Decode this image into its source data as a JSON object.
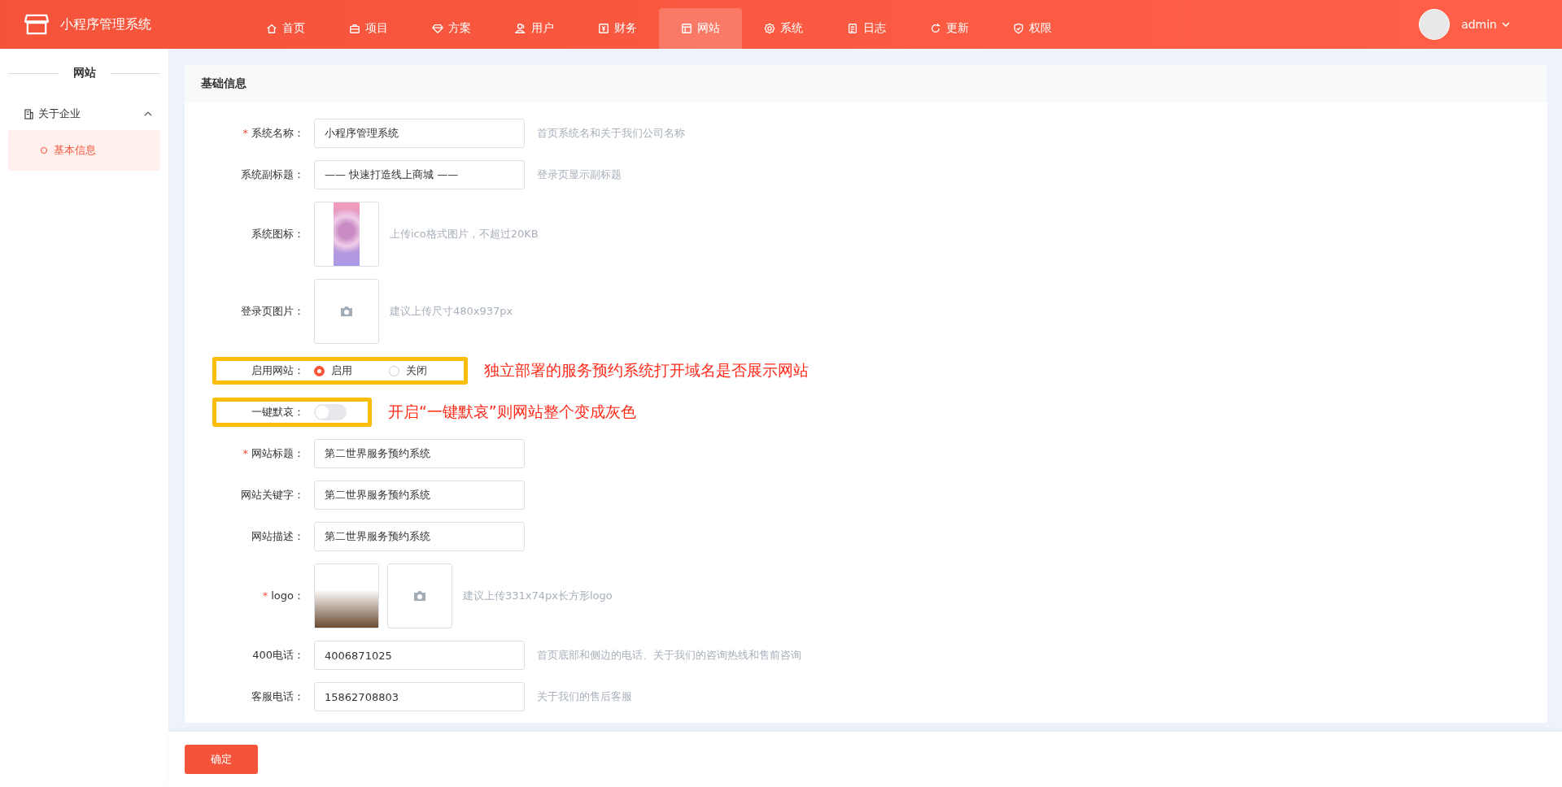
{
  "header": {
    "app_name": "小程序管理系统",
    "nav": [
      {
        "label": "首页",
        "selected": false
      },
      {
        "label": "项目",
        "selected": false
      },
      {
        "label": "方案",
        "selected": false
      },
      {
        "label": "用户",
        "selected": false
      },
      {
        "label": "财务",
        "selected": false
      },
      {
        "label": "网站",
        "selected": true
      },
      {
        "label": "系统",
        "selected": false
      },
      {
        "label": "日志",
        "selected": false
      },
      {
        "label": "更新",
        "selected": false
      },
      {
        "label": "权限",
        "selected": false
      }
    ],
    "user": {
      "name": "admin"
    }
  },
  "sidebar": {
    "title": "网站",
    "groups": [
      {
        "label": "关于企业",
        "expanded": true,
        "children": [
          {
            "label": "基本信息",
            "selected": true
          }
        ]
      }
    ]
  },
  "card": {
    "title": "基础信息",
    "rows": [
      {
        "kind": "input",
        "label": "系统名称：",
        "required_mark": "*",
        "value": "小程序管理系统",
        "hint": "首页系统名和关于我们公司名称"
      },
      {
        "kind": "input",
        "label": "系统副标题：",
        "value": "—— 快速打造线上商城 ——",
        "hint": "登录页显示副标题"
      },
      {
        "kind": "image",
        "label": "系统图标：",
        "hint": "上传ico格式图片，不超过20KB"
      },
      {
        "kind": "upload",
        "label": "登录页图片：",
        "hint": "建议上传尺寸480x937px"
      },
      {
        "kind": "radio",
        "label": "启用网站：",
        "options": [
          {
            "label": "启用",
            "selected": true
          },
          {
            "label": "关闭",
            "selected": false
          }
        ],
        "annotation": "独立部署的服务预约系统打开域名是否展示网站"
      },
      {
        "kind": "switch",
        "label": "一键默哀：",
        "on": false,
        "annotation": "开启“一键默哀”则网站整个变成灰色"
      },
      {
        "kind": "input",
        "label": "网站标题：",
        "required_mark": "*",
        "value": "第二世界服务预约系统"
      },
      {
        "kind": "input",
        "label": "网站关键字：",
        "value": "第二世界服务预约系统"
      },
      {
        "kind": "input",
        "label": "网站描述：",
        "value": "第二世界服务预约系统"
      },
      {
        "kind": "photo-upload",
        "label": "logo：",
        "required_mark": "*",
        "hint": "建议上传331x74px长方形logo"
      },
      {
        "kind": "input",
        "label": "400电话：",
        "value": "4006871025",
        "hint": "首页底部和侧边的电话、关于我们的咨询热线和售前咨询"
      },
      {
        "kind": "input",
        "label": "客服电话：",
        "value": "15862708803",
        "hint": "关于我们的售后客服"
      }
    ]
  },
  "footer": {
    "submit": "确定"
  }
}
